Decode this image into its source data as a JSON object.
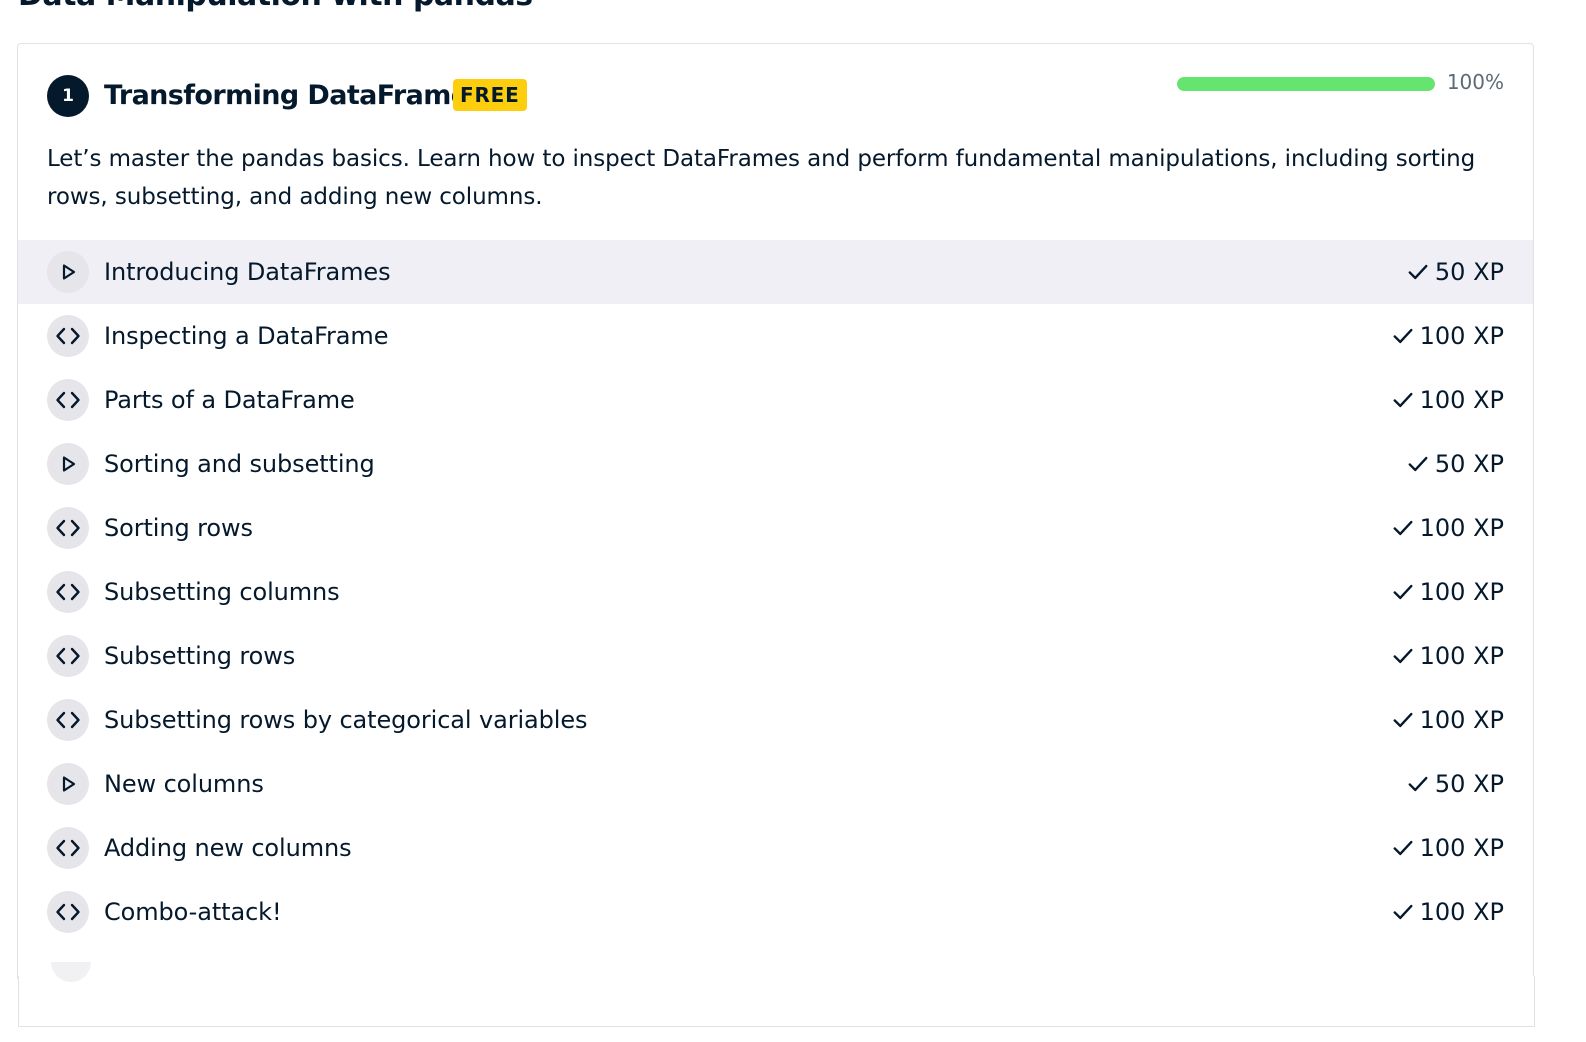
{
  "course": {
    "title": "Data Manipulation with pandas"
  },
  "chapter": {
    "number": "1",
    "title": "Transforming DataFrames",
    "badge": "FREE",
    "progress": {
      "percent": 100,
      "label": "100%"
    },
    "description": "Let’s master the pandas basics. Learn how to inspect DataFrames and perform fundamental manipulations, including sorting rows, subsetting, and adding new columns.",
    "exercises": [
      {
        "title": "Introducing DataFrames",
        "xp": "50 XP",
        "type": "video",
        "completed": true,
        "active": true
      },
      {
        "title": "Inspecting a DataFrame",
        "xp": "100 XP",
        "type": "code",
        "completed": true
      },
      {
        "title": "Parts of a DataFrame",
        "xp": "100 XP",
        "type": "code",
        "completed": true
      },
      {
        "title": "Sorting and subsetting",
        "xp": "50 XP",
        "type": "video",
        "completed": true
      },
      {
        "title": "Sorting rows",
        "xp": "100 XP",
        "type": "code",
        "completed": true
      },
      {
        "title": "Subsetting columns",
        "xp": "100 XP",
        "type": "code",
        "completed": true
      },
      {
        "title": "Subsetting rows",
        "xp": "100 XP",
        "type": "code",
        "completed": true
      },
      {
        "title": "Subsetting rows by categorical variables",
        "xp": "100 XP",
        "type": "code",
        "completed": true
      },
      {
        "title": "New columns",
        "xp": "50 XP",
        "type": "video",
        "completed": true
      },
      {
        "title": "Adding new columns",
        "xp": "100 XP",
        "type": "code",
        "completed": true
      },
      {
        "title": "Combo-attack!",
        "xp": "100 XP",
        "type": "code",
        "completed": true
      }
    ]
  },
  "colors": {
    "navy": "#05192d",
    "progress_green": "#65e470",
    "badge_yellow": "#fcce0d",
    "row_highlight": "#efeff5",
    "icon_bg": "#e5e5ea"
  },
  "icons": {
    "video": "play-icon",
    "code": "code-brackets-icon",
    "completed": "checkmark-icon"
  }
}
